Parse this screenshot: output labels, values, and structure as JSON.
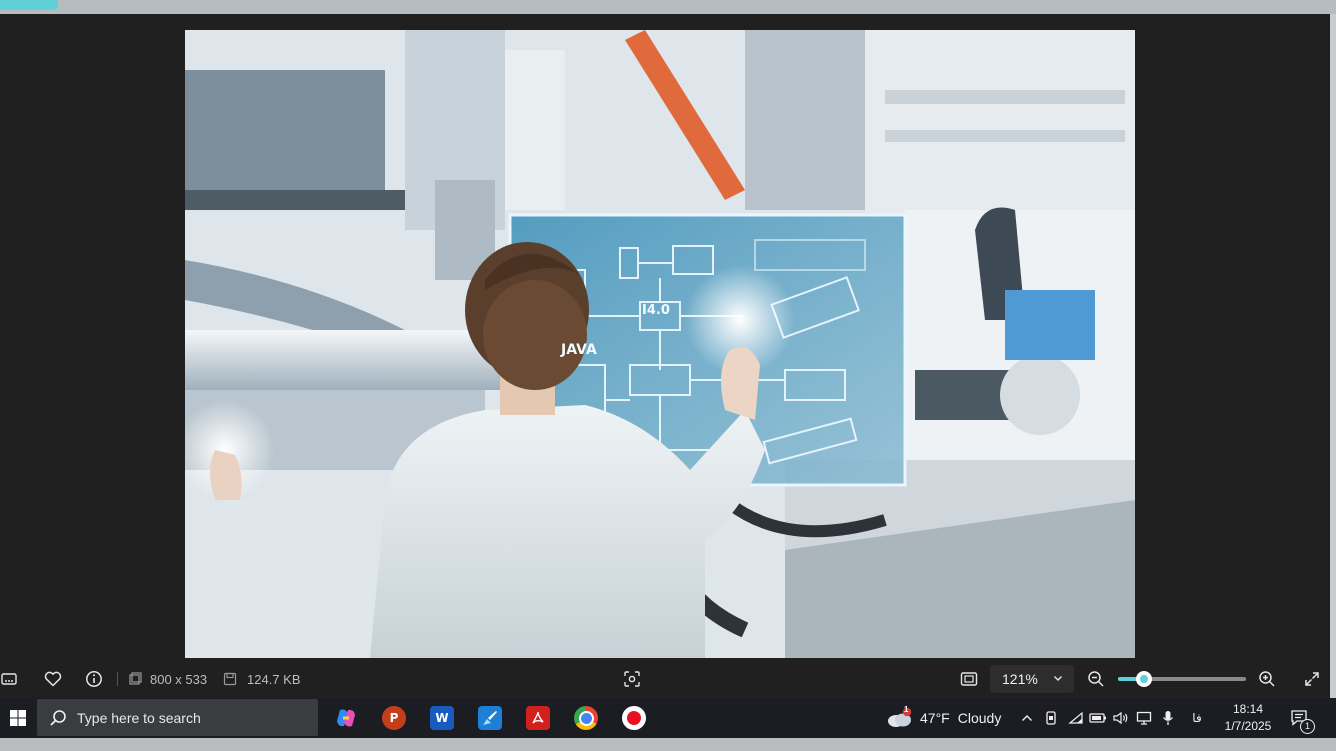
{
  "toolbar": {
    "dimensions": "800 x 533",
    "file_size": "124.7 KB",
    "zoom_level": "121%",
    "zoom_fraction": 0.2
  },
  "photo": {
    "labels": {
      "hologram_title": "I4.0",
      "hologram_subtitle": "JAVA"
    }
  },
  "taskbar": {
    "search_placeholder": "Type here to search",
    "apps": [
      "copilot-icon",
      "powerpoint-icon",
      "word-icon",
      "paint-icon",
      "acrobat-icon",
      "chrome-icon",
      "recorder-icon"
    ],
    "weather_temp": "47°F",
    "weather_desc": "Cloudy",
    "weather_badge": "1",
    "tray_lang": "فا",
    "time": "18:14",
    "date": "1/7/2025",
    "notification_count": "1"
  }
}
